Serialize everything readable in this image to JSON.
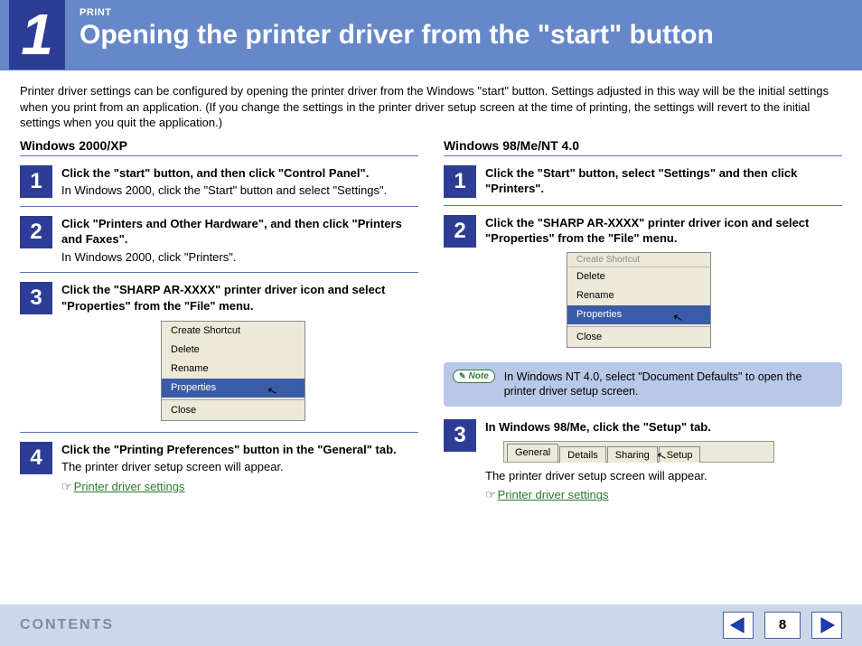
{
  "header": {
    "chapter_number": "1",
    "label": "PRINT",
    "title": "Opening the printer driver from the \"start\" button"
  },
  "intro": "Printer driver settings can be configured by opening the printer driver from the Windows \"start\" button. Settings adjusted in this way will be the initial settings when you print from an application. (If you change the settings in the printer driver setup screen at the time of printing, the settings will revert to the initial settings when you quit the application.)",
  "left": {
    "heading": "Windows 2000/XP",
    "steps": {
      "s1": {
        "num": "1",
        "title": "Click the \"start\" button, and then click \"Control Panel\".",
        "sub": "In Windows 2000, click the \"Start\" button and select \"Settings\"."
      },
      "s2": {
        "num": "2",
        "title": "Click \"Printers and Other Hardware\", and then click \"Printers and Faxes\".",
        "sub": "In Windows 2000, click \"Printers\"."
      },
      "s3": {
        "num": "3",
        "title": "Click the \"SHARP AR-XXXX\" printer driver icon and select \"Properties\" from the \"File\" menu."
      },
      "s4": {
        "num": "4",
        "title": "Click the \"Printing Preferences\" button in the \"General\" tab.",
        "sub": "The printer driver setup screen will appear."
      }
    },
    "menu": {
      "r1": "Create Shortcut",
      "r2": "Delete",
      "r3": "Rename",
      "r4": "Properties",
      "r5": "Close"
    },
    "link": "Printer driver settings"
  },
  "right": {
    "heading": "Windows 98/Me/NT 4.0",
    "steps": {
      "s1": {
        "num": "1",
        "title": "Click the \"Start\" button, select \"Settings\" and then click \"Printers\"."
      },
      "s2": {
        "num": "2",
        "title": "Click the \"SHARP AR-XXXX\" printer driver icon and select \"Properties\" from the \"File\" menu."
      },
      "s3": {
        "num": "3",
        "title": "In Windows 98/Me, click the \"Setup\" tab.",
        "sub": "The printer driver setup screen will appear."
      }
    },
    "menu": {
      "r0": "Create Shortcut",
      "r1": "Delete",
      "r2": "Rename",
      "r3": "Properties",
      "r4": "Close"
    },
    "note": {
      "badge": "Note",
      "text": "In Windows NT 4.0, select \"Document Defaults\" to open the printer driver setup screen."
    },
    "tabs": {
      "t1": "General",
      "t2": "Details",
      "t3": "Sharing",
      "t4": "Setup"
    },
    "link": "Printer driver settings"
  },
  "footer": {
    "contents": "CONTENTS",
    "page": "8"
  }
}
